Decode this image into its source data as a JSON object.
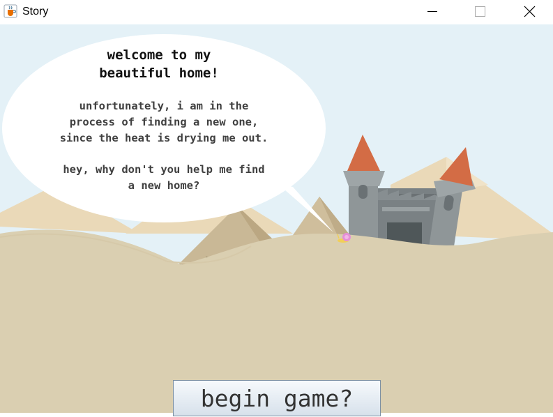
{
  "window": {
    "title": "Story",
    "app_icon": "java-coffee-cup-icon",
    "controls": [
      "minimize-icon",
      "maximize-icon",
      "close-icon"
    ]
  },
  "speech_bubble": {
    "title": "welcome to my\nbeautiful home!",
    "paragraph_1": "unfortunately, i am in the\nprocess of finding a new one,\nsince the heat is drying me out.",
    "paragraph_2": "hey, why don't you help me find\na new home?"
  },
  "begin_button": {
    "label": "begin game?"
  },
  "colors": {
    "sky": "#e4f1f7",
    "sand": "#dacfb1",
    "castle_stone": "#8f9698",
    "castle_roof": "#d36c45",
    "snail_shell": "#e58fd6"
  }
}
